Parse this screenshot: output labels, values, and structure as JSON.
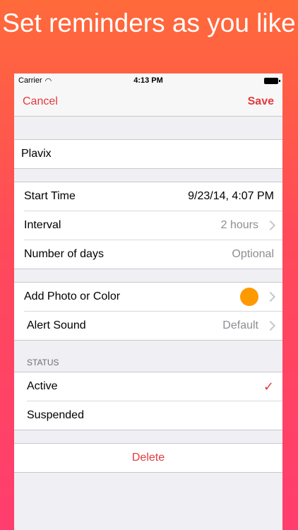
{
  "headline": "Set reminders as you like",
  "status": {
    "carrier": "Carrier",
    "time": "4:13 PM"
  },
  "nav": {
    "cancel": "Cancel",
    "save": "Save"
  },
  "name_field": {
    "value": "Plavix"
  },
  "schedule": {
    "start_label": "Start Time",
    "start_value": "9/23/14, 4:07 PM",
    "interval_label": "Interval",
    "interval_value": "2 hours",
    "days_label": "Number of days",
    "days_placeholder": "Optional"
  },
  "appearance": {
    "photo_label": "Add Photo or Color",
    "color": "#ff9900",
    "sound_label": "Alert Sound",
    "sound_value": "Default"
  },
  "status_section": {
    "header": "STATUS",
    "options": [
      {
        "label": "Active",
        "selected": true
      },
      {
        "label": "Suspended",
        "selected": false
      }
    ]
  },
  "delete_label": "Delete",
  "colors": {
    "accent": "#e33b3b",
    "gradient_top": "#ff6a3a",
    "gradient_bottom": "#ff3d6e"
  }
}
